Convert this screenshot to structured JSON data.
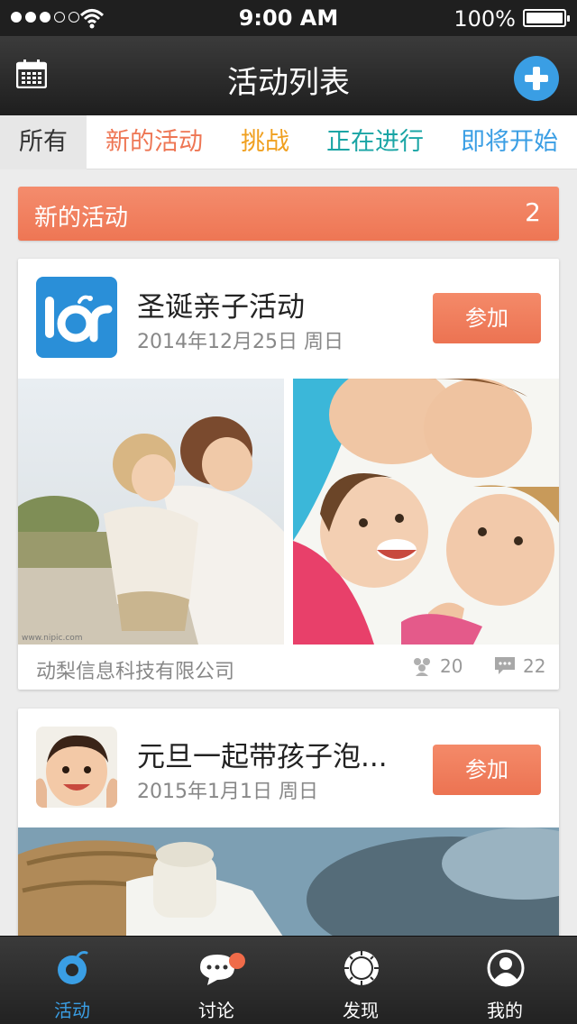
{
  "status_bar": {
    "time": "9:00 AM",
    "battery": "100%"
  },
  "nav": {
    "title": "活动列表",
    "left_icon": "calendar-icon",
    "right_icon": "add-icon"
  },
  "tabs": [
    {
      "label": "所有",
      "color": "#333333",
      "active": true
    },
    {
      "label": "新的活动",
      "color": "#ee7654"
    },
    {
      "label": "挑战",
      "color": "#f0a020"
    },
    {
      "label": "正在进行",
      "color": "#1aa5a5"
    },
    {
      "label": "即将开始",
      "color": "#3a9ee4"
    }
  ],
  "section": {
    "title": "新的活动",
    "count": "2"
  },
  "activities": [
    {
      "title": "圣诞亲子活动",
      "date": "2014年12月25日  周日",
      "join_label": "参加",
      "organizer": "动梨信息科技有限公司",
      "members": "20",
      "comments": "22"
    },
    {
      "title": "元旦一起带孩子泡...",
      "date": "2015年1月1日  周日",
      "join_label": "参加"
    }
  ],
  "tabbar": [
    {
      "label": "活动",
      "icon": "activity-icon",
      "active": true
    },
    {
      "label": "讨论",
      "icon": "chat-icon",
      "badge": true
    },
    {
      "label": "发现",
      "icon": "discover-icon"
    },
    {
      "label": "我的",
      "icon": "profile-icon"
    }
  ],
  "colors": {
    "accent": "#ee7654",
    "blue": "#3a9ee4",
    "dark": "#1f1f1f"
  }
}
